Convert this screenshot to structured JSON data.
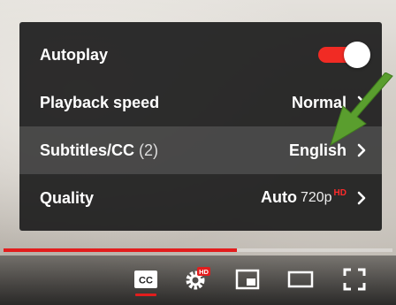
{
  "settings_menu": {
    "items": [
      {
        "label": "Autoplay",
        "toggle_on": true
      },
      {
        "label": "Playback speed",
        "value": "Normal"
      },
      {
        "label": "Subtitles/CC",
        "count": "(2)",
        "value": "English",
        "highlighted": true
      },
      {
        "label": "Quality",
        "value": "Auto",
        "sub_value": "720p",
        "badge": "HD"
      }
    ]
  },
  "player": {
    "progress": 0.6,
    "controls": [
      {
        "name": "subtitles-button",
        "icon": "cc-icon",
        "text": "CC",
        "active": true
      },
      {
        "name": "settings-button",
        "icon": "gear-icon",
        "badge": "HD"
      },
      {
        "name": "miniplayer-button",
        "icon": "miniplayer-icon"
      },
      {
        "name": "theater-mode-button",
        "icon": "theater-icon"
      },
      {
        "name": "fullscreen-button",
        "icon": "fullscreen-icon"
      }
    ]
  },
  "colors": {
    "accent_red": "#e21d1d",
    "toggle_red": "#f12b24",
    "menu_bg": "#1c1c1c",
    "annotation_arrow": "#5a9e2e"
  }
}
